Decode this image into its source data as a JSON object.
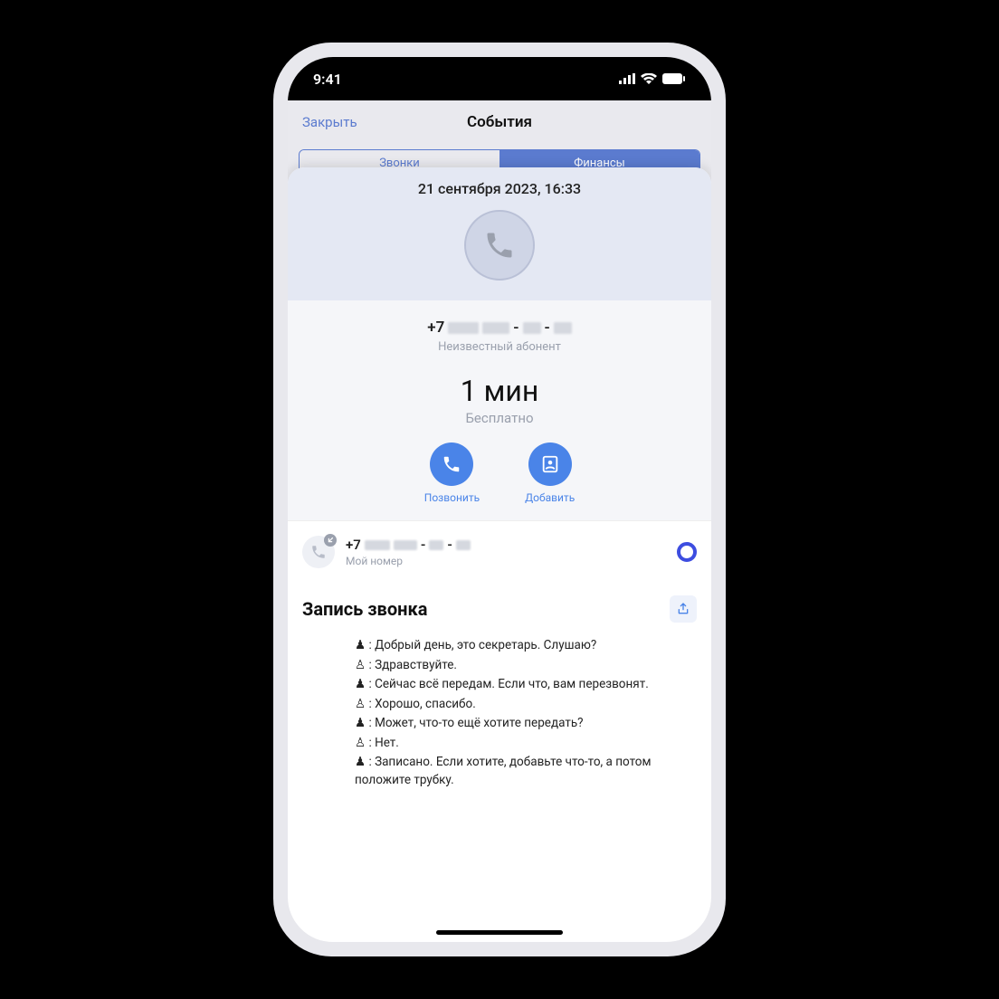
{
  "status_bar": {
    "time": "9:41"
  },
  "nav": {
    "close": "Закрыть",
    "title": "События"
  },
  "tabs": {
    "calls": "Звонки",
    "finance": "Финансы"
  },
  "sheet": {
    "datetime": "21 сентября 2023, 16:33",
    "phone_prefix": "+7",
    "caller_sub": "Неизвестный абонент",
    "duration": "1 мин",
    "duration_sub": "Бесплатно",
    "actions": {
      "call": "Позвонить",
      "add": "Добавить"
    }
  },
  "my": {
    "phone_prefix": "+7",
    "sub": "Мой номер"
  },
  "transcript": {
    "title": "Запись звонка",
    "lines": [
      {
        "who": "bot",
        "text": ": Добрый день, это секретарь. Слушаю?"
      },
      {
        "who": "user",
        "text": ": Здравствуйте."
      },
      {
        "who": "bot",
        "text": ": Сейчас всё передам. Если что, вам перезвонят."
      },
      {
        "who": "user",
        "text": ": Хорошо, спасибо."
      },
      {
        "who": "bot",
        "text": ": Может, что-то ещё хотите передать?"
      },
      {
        "who": "user",
        "text": ": Нет."
      },
      {
        "who": "bot",
        "text": ": Записано. Если хотите, добавьте что-то, а потом положите трубку."
      }
    ]
  },
  "icons": {
    "bot_glyph": "♟",
    "user_glyph": "♙"
  }
}
